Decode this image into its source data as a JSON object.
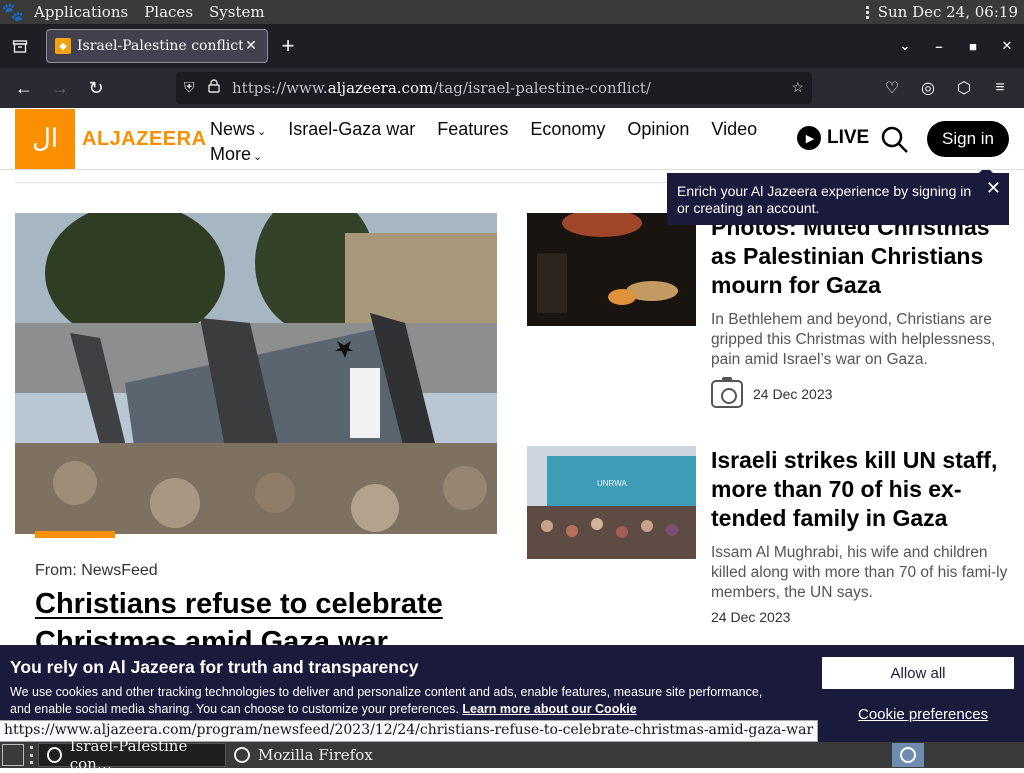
{
  "os_panel": {
    "menus": [
      "Applications",
      "Places",
      "System"
    ],
    "clock": "Sun Dec 24, 06:19"
  },
  "browser": {
    "tab_title": "Israel-Palestine conflict",
    "url_prefix": "https://www.",
    "url_domain": "aljazeera.com",
    "url_path": "/tag/israel-palestine-conflict/"
  },
  "site": {
    "logo_text": "ALJAZEERA",
    "nav": {
      "news": "News",
      "war": "Israel-Gaza war",
      "features": "Features",
      "economy": "Economy",
      "opinion": "Opinion",
      "video": "Video",
      "more": "More"
    },
    "live_label": "LIVE",
    "signin_label": "Sign in",
    "tooltip_text": "Enrich your Al Jazeera experience by signing in or creating an account."
  },
  "hero": {
    "source": "From: NewsFeed",
    "title": "Christians refuse to celebrate Christmas amid Gaza war"
  },
  "cards": [
    {
      "headline": "Photos: Muted Christmas as Palestinian Christians mourn for Gaza",
      "summary": "In Bethlehem and beyond, Christians are gripped this Christmas with helplessness, pain amid Israel’s war on Gaza.",
      "date": "24 Dec 2023"
    },
    {
      "headline": "Israeli strikes kill UN staff, more than 70 of his ex-tended family in Gaza",
      "summary": "Issam Al Mughrabi, his wife and children killed along with more than 70 of his fami-ly members, the UN says.",
      "date": "24 Dec 2023"
    }
  ],
  "cookie": {
    "title": "You rely on Al Jazeera for truth and transparency",
    "body": "We use cookies and other tracking technologies to deliver and personalize content and ads, enable features, measure site performance, and enable social media sharing. You can choose to customize your preferences.",
    "link": "Learn more about our Cookie",
    "allow_label": "Allow all",
    "prefs_label": "Cookie preferences"
  },
  "status_url": "https://www.aljazeera.com/program/newsfeed/2023/12/24/christians-refuse-to-celebrate-christmas-amid-gaza-war",
  "taskbar": {
    "task1": "Israel-Palestine con…",
    "task2": "Mozilla Firefox"
  }
}
